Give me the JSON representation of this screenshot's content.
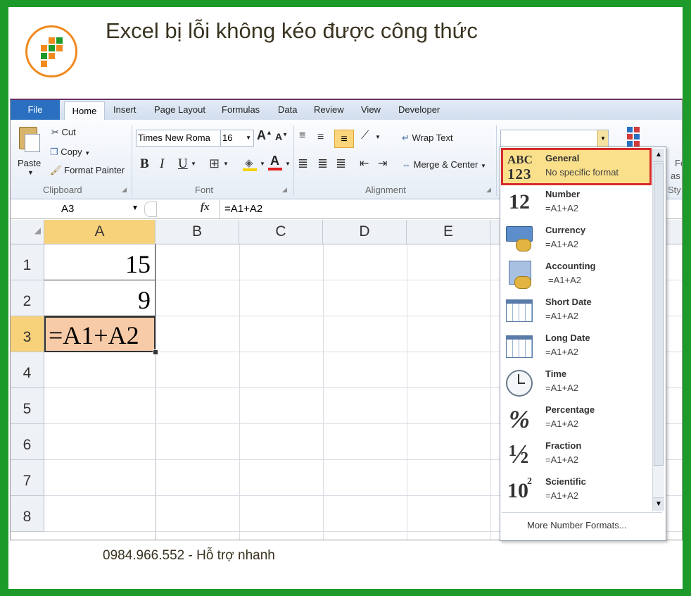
{
  "title": "Excel bị lỗi không kéo được công thức",
  "footer": "0984.966.552 - Hỗ trợ nhanh",
  "tabs": [
    "File",
    "Home",
    "Insert",
    "Page Layout",
    "Formulas",
    "Data",
    "Review",
    "View",
    "Developer"
  ],
  "clipboard": {
    "paste": "Paste",
    "cut": "Cut",
    "copy": "Copy",
    "format_painter": "Format Painter",
    "label": "Clipboard"
  },
  "font": {
    "name": "Times New Roma",
    "size": "16",
    "bold": "B",
    "italic": "I",
    "underline": "U",
    "label": "Font"
  },
  "alignment": {
    "wrap": "Wrap Text",
    "merge": "Merge & Center",
    "label": "Alignment"
  },
  "styles": {
    "f": "Fo",
    "as": "as",
    "sty": "Sty"
  },
  "formula_bar": {
    "name_box": "A3",
    "fx": "fx",
    "formula": "=A1+A2"
  },
  "columns": [
    "A",
    "B",
    "C",
    "D",
    "E"
  ],
  "rows": [
    "1",
    "2",
    "3",
    "4",
    "5",
    "6",
    "7",
    "8"
  ],
  "cells": {
    "a1": "15",
    "a2": "9",
    "a3": "=A1+A2"
  },
  "number_format": {
    "items": [
      {
        "name": "General",
        "sub": "No specific format",
        "icon": "general-abc-icon"
      },
      {
        "name": "Number",
        "sub": "=A1+A2",
        "icon": "number-12-icon"
      },
      {
        "name": "Currency",
        "sub": "=A1+A2",
        "icon": "currency-icon"
      },
      {
        "name": "Accounting",
        "sub": "=A1+A2",
        "icon": "accounting-icon"
      },
      {
        "name": "Short Date",
        "sub": "=A1+A2",
        "icon": "calendar-icon"
      },
      {
        "name": "Long Date",
        "sub": "=A1+A2",
        "icon": "calendar-icon"
      },
      {
        "name": "Time",
        "sub": "=A1+A2",
        "icon": "clock-icon"
      },
      {
        "name": "Percentage",
        "sub": "=A1+A2",
        "icon": "percent-icon"
      },
      {
        "name": "Fraction",
        "sub": "=A1+A2",
        "icon": "fraction-icon"
      },
      {
        "name": "Scientific",
        "sub": "=A1+A2",
        "icon": "scientific-icon"
      }
    ],
    "more": "More Number Formats...",
    "icon_text": {
      "abc": "ABC",
      "n123": "123",
      "n12": "12",
      "pct": "%",
      "half": "½",
      "sci_base": "10",
      "sci_exp": "2"
    }
  },
  "colors": {
    "frame": "#1d9a2a",
    "highlight_border": "#d62b2b",
    "selected_cell": "#f8cba8",
    "header_active": "#f7d27a"
  }
}
